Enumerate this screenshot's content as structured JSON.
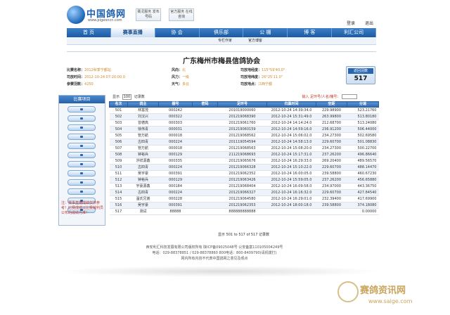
{
  "header": {
    "site_name": "中国鸽网",
    "site_url": "www.pigeoncn.com",
    "badges": [
      "赛况服务 发布号码",
      "官方服务 在线咨询"
    ],
    "links": [
      "登录",
      "退出"
    ]
  },
  "nav": {
    "items": [
      "首 页",
      "赛事直播",
      "协 会",
      "俱乐部",
      "公 棚",
      "博 客",
      "利汇公司"
    ],
    "active_index": 1
  },
  "subnav": {
    "items": [
      "专栏作家",
      "官方博客"
    ]
  },
  "race": {
    "title": "广东梅州市梅县信鸽协会",
    "fields": [
      {
        "label": "比赛名称：",
        "value": "2012秋季宁都站"
      },
      {
        "label": "风向：",
        "value": "北"
      },
      {
        "label": "司放地经度：",
        "value": "115°59'40.0\""
      },
      {
        "label": "司放时间：",
        "value": "2012-10-24 07:20:00.0"
      },
      {
        "label": "风力：",
        "value": "一级"
      },
      {
        "label": "司放地纬度：",
        "value": "26°25'11.0\""
      },
      {
        "label": "参赛羽数：",
        "value": "4250"
      },
      {
        "label": "天气：",
        "value": "多云"
      },
      {
        "label": "司放地点：",
        "value": "江西宁都"
      }
    ],
    "return_label": "返回羽数",
    "return_count": "517"
  },
  "sidebar": {
    "title": "比赛项目",
    "button_count": 12,
    "note": "注：赛事直播成绩仅供参考！比赛成绩以比赛裁判员公布的成绩为准！"
  },
  "controls": {
    "show_label": "显示",
    "page_size": "100",
    "records_label": "记录数",
    "search_label": "输入 足环号/人名/棚号："
  },
  "table": {
    "columns": [
      "名次",
      "鸽主",
      "棚号",
      "密码",
      "足环号",
      "归巢时间",
      "空距",
      "分速"
    ],
    "rows": [
      [
        "501",
        "林富茂",
        "000242",
        "",
        "201019000060",
        "2012-10-24 14:39:34.0",
        "229.98900",
        "523.21760"
      ],
      [
        "502",
        "刘汉兴",
        "000322",
        "",
        "201219068390",
        "2012-10-24 15:31:49.0",
        "263.99800",
        "513.80180"
      ],
      [
        "503",
        "曾德高",
        "000303",
        "",
        "201219061760",
        "2012-10-24 14:14:24.0",
        "212.68700",
        "513.24080"
      ],
      [
        "504",
        "徐伟青",
        "000031",
        "",
        "201219060159",
        "2012-10-24 14:59:16.0",
        "236.91200",
        "506.44000"
      ],
      [
        "505",
        "管万航",
        "000018",
        "",
        "201219068562",
        "2012-10-24 15:06:02.0",
        "234.27300",
        "502.69580"
      ],
      [
        "506",
        "古四青",
        "000224",
        "",
        "201119054594",
        "2012-10-24 14:58:13.0",
        "229.60700",
        "501.08830"
      ],
      [
        "507",
        "管万航",
        "000018",
        "",
        "201219068563",
        "2012-10-24 15:08:20.0",
        "234.27300",
        "500.22700"
      ],
      [
        "508",
        "钟裕兵",
        "000129",
        "",
        "211219068693",
        "2012-10-24 15:17:31.0",
        "237.26200",
        "496.86640"
      ],
      [
        "509",
        "洪祥源鑫",
        "000335",
        "",
        "201219065676",
        "2012-10-24 16:29:33.0",
        "269.20400",
        "489.56570"
      ],
      [
        "510",
        "古四青",
        "000224",
        "",
        "201219066328",
        "2012-10-24 15:10:22.0",
        "229.60700",
        "488.14470"
      ],
      [
        "511",
        "吴宇豪",
        "000391",
        "",
        "201219062352",
        "2012-10-24 16:00:05.0",
        "239.58800",
        "460.67230"
      ],
      [
        "512",
        "钟裕兵",
        "000129",
        "",
        "201219063426",
        "2012-10-24 15:59:05.0",
        "237.26200",
        "456.65880"
      ],
      [
        "513",
        "宇豪源鑫",
        "000184",
        "",
        "201219068404",
        "2012-10-24 16:09:58.0",
        "234.97000",
        "443.36750"
      ],
      [
        "514",
        "古四青",
        "000224",
        "",
        "201219066327",
        "2012-10-24 16:16:32.0",
        "229.60700",
        "427.84540"
      ],
      [
        "515",
        "温氏兄弟",
        "000228",
        "",
        "201219064580",
        "2012-10-24 16:29:01.0",
        "232.39400",
        "417.69900"
      ],
      [
        "516",
        "吴宇豪",
        "000391",
        "",
        "201219062353",
        "2012-10-24 18:00:18.0",
        "239.58800",
        "374.18080"
      ],
      [
        "517",
        "测试",
        "88888",
        "",
        "888888888888",
        "",
        "",
        "0.00000"
      ]
    ]
  },
  "pager": {
    "text": "显示 501 to 517 of 517 记录数"
  },
  "footer": {
    "lines": [
      "西安利汇科技发展有限公司版权所有 陕ICP备09025048号 公安备案110105004249号",
      "电话：029-88378851 / 029-88378860  800电话：800-8409790(请机拨打)",
      "网内所有内容不代表中国鸽网之意见及观点"
    ]
  },
  "watermark": {
    "text": "赛鸽资讯网",
    "url": "www.saige.com"
  }
}
